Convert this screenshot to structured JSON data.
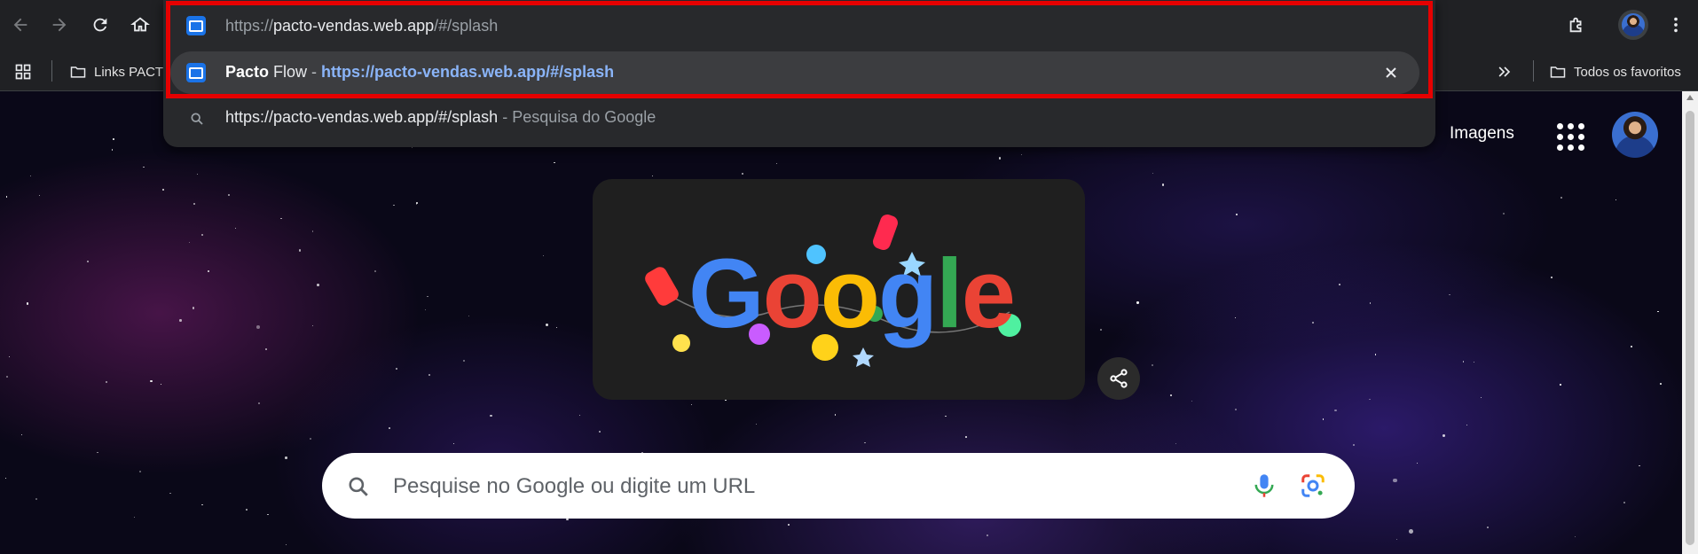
{
  "toolbar": {
    "back_icon": "arrow-left-icon",
    "forward_icon": "arrow-right-icon",
    "reload_icon": "reload-icon",
    "home_icon": "home-icon",
    "extensions_icon": "puzzle-icon"
  },
  "bookmarks_bar": {
    "items": [
      {
        "label": "Links PACTO",
        "icon": "folder-icon"
      }
    ],
    "all_bookmarks_label": "Todos os favoritos"
  },
  "omnibox": {
    "typed_prefix": "https://",
    "typed_host": "pacto-vendas.web.app",
    "typed_path": "/#/splash",
    "suggestions": [
      {
        "title_bold": "Pacto",
        "title_rest": " Flow",
        "separator": " - ",
        "url": "https://pacto-vendas.web.app/#/splash"
      },
      {
        "query": "https://pacto-vendas.web.app/#/splash",
        "separator": " - ",
        "source": "Pesquisa do Google"
      }
    ]
  },
  "google_page": {
    "images_link": "Imagens",
    "logo_letters": [
      "G",
      "o",
      "o",
      "g",
      "l",
      "e"
    ],
    "logo_colors": [
      "#4285f4",
      "#ea4335",
      "#fbbc05",
      "#4285f4",
      "#34a853",
      "#ea4335"
    ],
    "search_placeholder": "Pesquise no Google ou digite um URL"
  },
  "colors": {
    "highlight_frame": "#e60000",
    "link_blue": "#8ab4f8"
  }
}
